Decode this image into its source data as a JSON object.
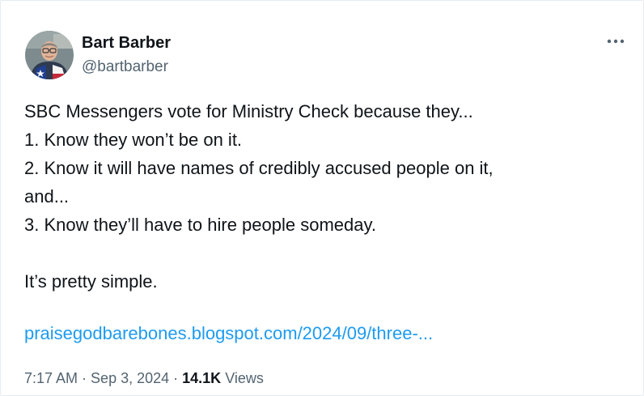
{
  "author": {
    "name": "Bart Barber",
    "handle": "@bartbarber"
  },
  "tweet": {
    "lines": [
      "SBC Messengers vote for Ministry Check because they...",
      "1. Know they won’t be on it.",
      "2. Know it will have names of credibly accused people on it,",
      "and...",
      "3. Know they’ll have to hire people someday.",
      "",
      "It’s pretty simple."
    ],
    "link": "praisegodbarebones.blogspot.com/2024/09/three-..."
  },
  "meta": {
    "time": "7:17 AM",
    "separator": "·",
    "date": "Sep 3, 2024",
    "views_count": "14.1K",
    "views_label": "Views"
  },
  "icons": {
    "more": "more-horizontal-icon",
    "avatar": "profile-photo"
  },
  "colors": {
    "text": "#0f1419",
    "secondary": "#536471",
    "link": "#1d9bf0"
  }
}
